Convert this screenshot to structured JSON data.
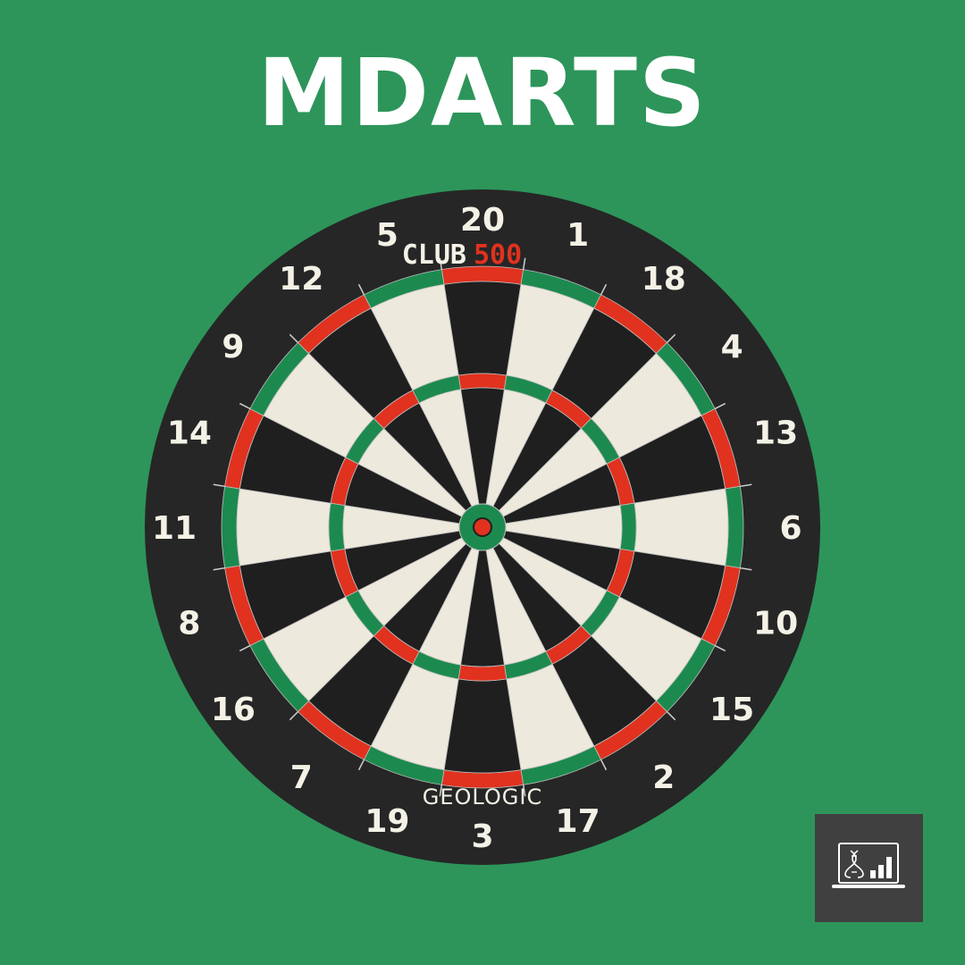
{
  "header": {
    "title": "MDARTS"
  },
  "dartboard": {
    "numbers": [
      "20",
      "1",
      "18",
      "4",
      "13",
      "6",
      "10",
      "15",
      "2",
      "17",
      "3",
      "19",
      "7",
      "16",
      "8",
      "11",
      "14",
      "9",
      "12",
      "5"
    ],
    "brand_top": {
      "left": "CLUB",
      "right": "500"
    },
    "brand_bottom": "GEOLOGIC",
    "colors": {
      "background": "#2d955a",
      "surround": "#262626",
      "black_segment": "#1f1f1f",
      "white_segment": "#ede9dc",
      "red_ring": "#e0321f",
      "green_ring": "#1c8a4e",
      "number": "#f4f1e6",
      "brand_red": "#e0321f"
    }
  },
  "logo": {
    "icon": "laptop-dna-chart-icon"
  }
}
